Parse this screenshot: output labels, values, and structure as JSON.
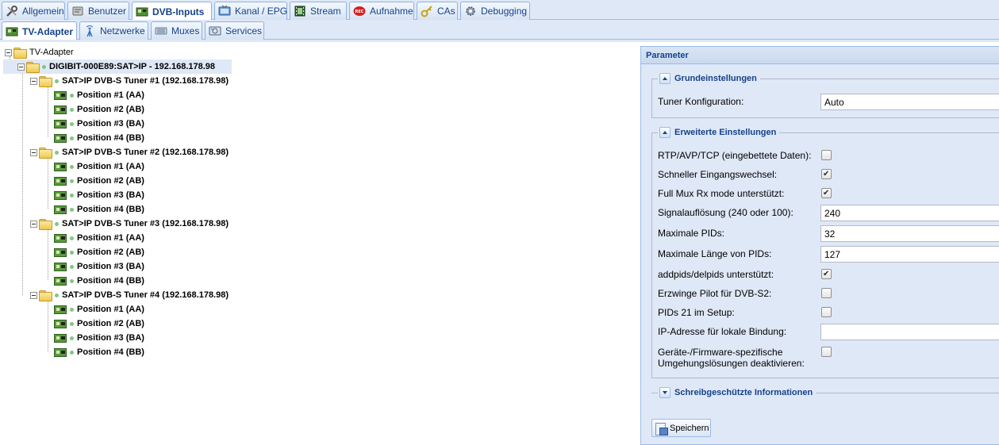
{
  "main_tabs": [
    {
      "label": "Allgemein",
      "icon": "wrench-icon"
    },
    {
      "label": "Benutzer",
      "icon": "tools-icon"
    },
    {
      "label": "DVB-Inputs",
      "icon": "tv-card-icon"
    },
    {
      "label": "Kanal / EPG",
      "icon": "tv-icon"
    },
    {
      "label": "Stream",
      "icon": "film-icon"
    },
    {
      "label": "Aufnahme",
      "icon": "rec-icon"
    },
    {
      "label": "CAs",
      "icon": "key-icon"
    },
    {
      "label": "Debugging",
      "icon": "gear-icon"
    }
  ],
  "sub_tabs": [
    {
      "label": "TV-Adapter",
      "icon": "tv-card-icon"
    },
    {
      "label": "Netzwerke",
      "icon": "antenna-icon"
    },
    {
      "label": "Muxes",
      "icon": "mux-icon"
    },
    {
      "label": "Services",
      "icon": "services-icon"
    }
  ],
  "tree": {
    "root": "TV-Adapter",
    "device": "DIGIBIT-000E89:SAT>IP - 192.168.178.98",
    "tuners": [
      {
        "label": "SAT>IP DVB-S Tuner #1 (192.168.178.98)",
        "positions": [
          "Position #1 (AA)",
          "Position #2 (AB)",
          "Position #3 (BA)",
          "Position #4 (BB)"
        ]
      },
      {
        "label": "SAT>IP DVB-S Tuner #2 (192.168.178.98)",
        "positions": [
          "Position #1 (AA)",
          "Position #2 (AB)",
          "Position #3 (BA)",
          "Position #4 (BB)"
        ]
      },
      {
        "label": "SAT>IP DVB-S Tuner #3 (192.168.178.98)",
        "positions": [
          "Position #1 (AA)",
          "Position #2 (AB)",
          "Position #3 (BA)",
          "Position #4 (BB)"
        ]
      },
      {
        "label": "SAT>IP DVB-S Tuner #4 (192.168.178.98)",
        "positions": [
          "Position #1 (AA)",
          "Position #2 (AB)",
          "Position #3 (BA)",
          "Position #4 (BB)"
        ]
      }
    ]
  },
  "parameter": {
    "title": "Parameter",
    "basic": {
      "legend": "Grundeinstellungen",
      "tuner_config_label": "Tuner Konfiguration:",
      "tuner_config_value": "Auto"
    },
    "advanced": {
      "legend": "Erweiterte Einstellungen",
      "rtp_label": "RTP/AVP/TCP (eingebettete Daten):",
      "rtp_checked": false,
      "fast_switch_label": "Schneller Eingangswechsel:",
      "fast_switch_checked": true,
      "full_mux_label": "Full Mux Rx mode unterstützt:",
      "full_mux_checked": true,
      "signal_label": "Signalauflösung (240 oder 100):",
      "signal_value": "240",
      "max_pids_label": "Maximale PIDs:",
      "max_pids_value": "32",
      "max_pid_len_label": "Maximale Länge von PIDs:",
      "max_pid_len_value": "127",
      "addpids_label": "addpids/delpids unterstützt:",
      "addpids_checked": true,
      "pilot_label": "Erzwinge Pilot für DVB-S2:",
      "pilot_checked": false,
      "pids21_label": "PIDs 21 im Setup:",
      "pids21_checked": false,
      "ip_bind_label": "IP-Adresse für lokale Bindung:",
      "ip_bind_value": "",
      "workaround_label_1": "Geräte-/Firmware-spezifische",
      "workaround_label_2": "Umgehungslösungen deaktivieren:",
      "workaround_checked": false
    },
    "readonly": {
      "legend": "Schreibgeschützte Informationen"
    },
    "save_label": "Speichern"
  }
}
